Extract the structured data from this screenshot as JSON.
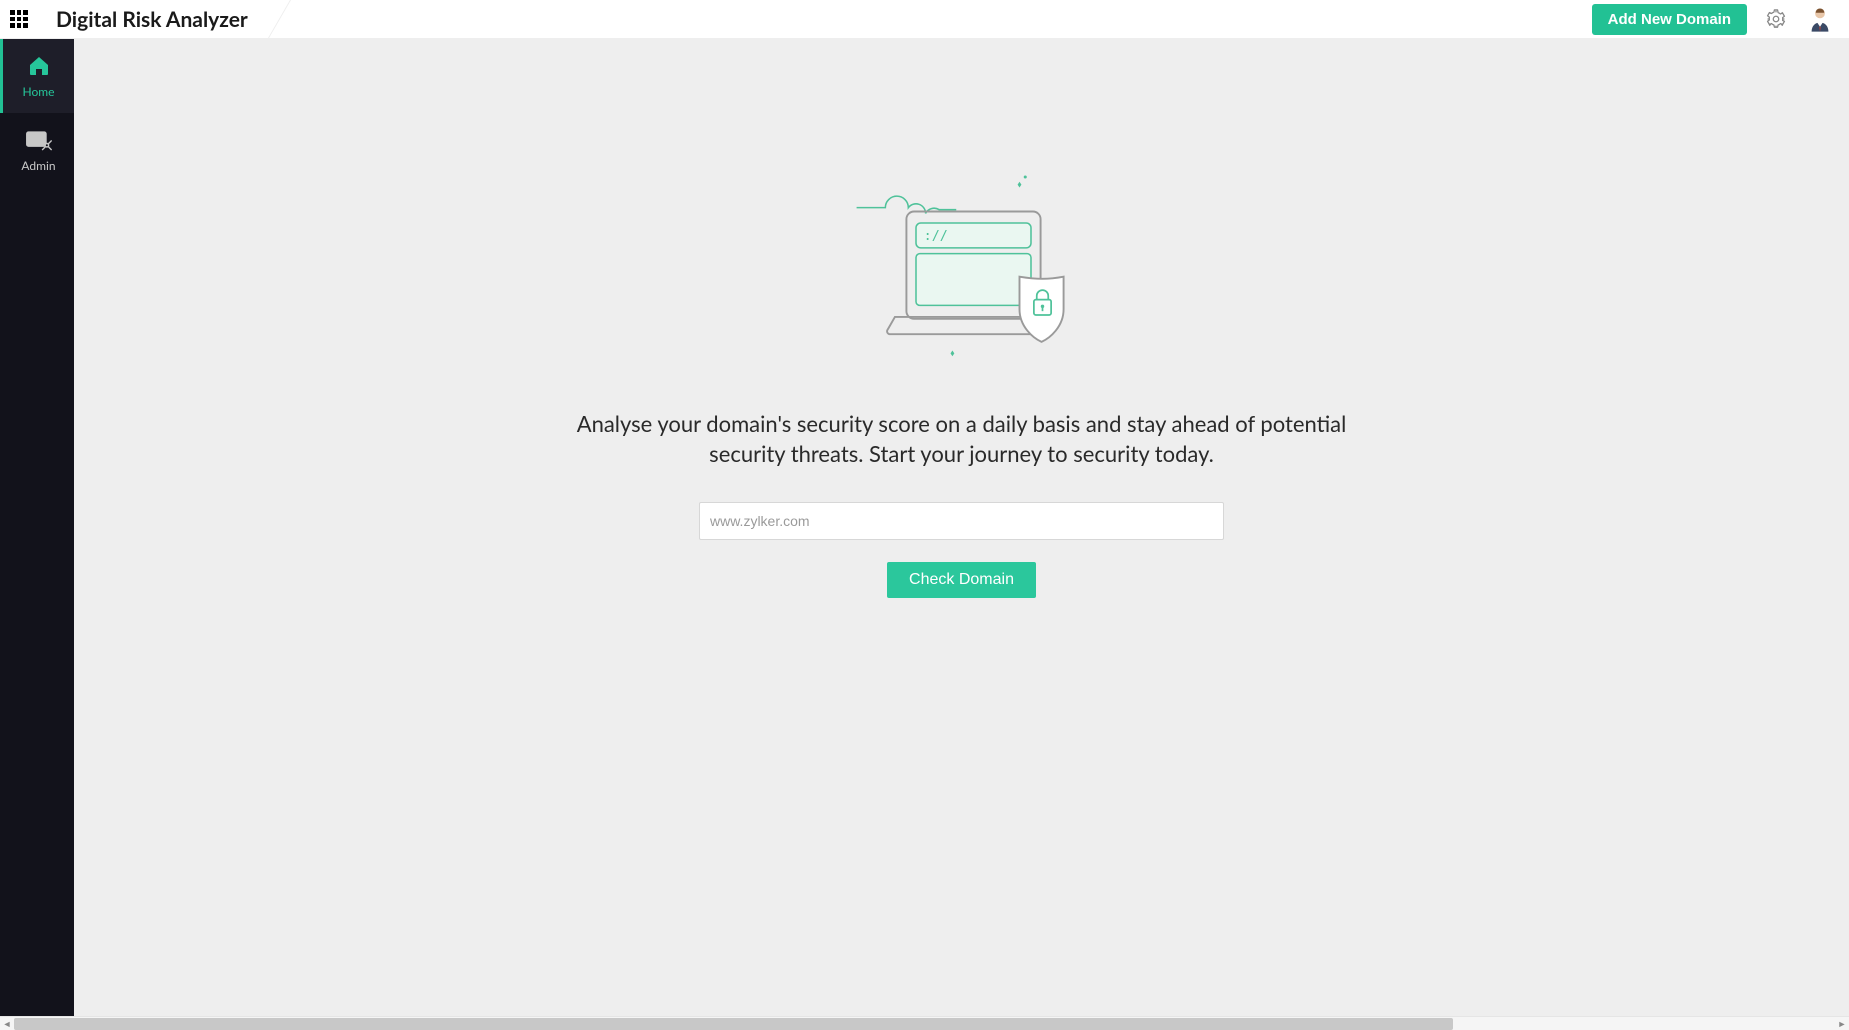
{
  "header": {
    "app_title": "Digital Risk Analyzer",
    "add_domain_label": "Add New Domain"
  },
  "sidebar": {
    "items": [
      {
        "label": "Home",
        "icon": "home-icon",
        "active": true
      },
      {
        "label": "Admin",
        "icon": "admin-icon",
        "active": false
      }
    ]
  },
  "main": {
    "hero_text": "Analyse your domain's security score on a daily basis and stay ahead of potential security threats. Start your journey to security today.",
    "domain_input": {
      "placeholder": "www.zylker.com",
      "value": ""
    },
    "check_button_label": "Check Domain"
  },
  "colors": {
    "accent": "#22c194",
    "sidebar_bg": "#12121b",
    "main_bg": "#eeeeee"
  }
}
